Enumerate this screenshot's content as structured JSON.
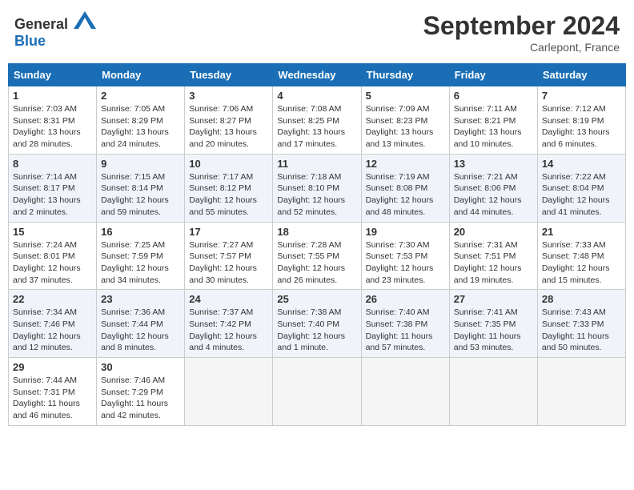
{
  "header": {
    "logo_general": "General",
    "logo_blue": "Blue",
    "month_title": "September 2024",
    "location": "Carlepont, France"
  },
  "weekdays": [
    "Sunday",
    "Monday",
    "Tuesday",
    "Wednesday",
    "Thursday",
    "Friday",
    "Saturday"
  ],
  "weeks": [
    [
      {
        "day": "1",
        "sunrise": "Sunrise: 7:03 AM",
        "sunset": "Sunset: 8:31 PM",
        "daylight": "Daylight: 13 hours and 28 minutes."
      },
      {
        "day": "2",
        "sunrise": "Sunrise: 7:05 AM",
        "sunset": "Sunset: 8:29 PM",
        "daylight": "Daylight: 13 hours and 24 minutes."
      },
      {
        "day": "3",
        "sunrise": "Sunrise: 7:06 AM",
        "sunset": "Sunset: 8:27 PM",
        "daylight": "Daylight: 13 hours and 20 minutes."
      },
      {
        "day": "4",
        "sunrise": "Sunrise: 7:08 AM",
        "sunset": "Sunset: 8:25 PM",
        "daylight": "Daylight: 13 hours and 17 minutes."
      },
      {
        "day": "5",
        "sunrise": "Sunrise: 7:09 AM",
        "sunset": "Sunset: 8:23 PM",
        "daylight": "Daylight: 13 hours and 13 minutes."
      },
      {
        "day": "6",
        "sunrise": "Sunrise: 7:11 AM",
        "sunset": "Sunset: 8:21 PM",
        "daylight": "Daylight: 13 hours and 10 minutes."
      },
      {
        "day": "7",
        "sunrise": "Sunrise: 7:12 AM",
        "sunset": "Sunset: 8:19 PM",
        "daylight": "Daylight: 13 hours and 6 minutes."
      }
    ],
    [
      {
        "day": "8",
        "sunrise": "Sunrise: 7:14 AM",
        "sunset": "Sunset: 8:17 PM",
        "daylight": "Daylight: 13 hours and 2 minutes."
      },
      {
        "day": "9",
        "sunrise": "Sunrise: 7:15 AM",
        "sunset": "Sunset: 8:14 PM",
        "daylight": "Daylight: 12 hours and 59 minutes."
      },
      {
        "day": "10",
        "sunrise": "Sunrise: 7:17 AM",
        "sunset": "Sunset: 8:12 PM",
        "daylight": "Daylight: 12 hours and 55 minutes."
      },
      {
        "day": "11",
        "sunrise": "Sunrise: 7:18 AM",
        "sunset": "Sunset: 8:10 PM",
        "daylight": "Daylight: 12 hours and 52 minutes."
      },
      {
        "day": "12",
        "sunrise": "Sunrise: 7:19 AM",
        "sunset": "Sunset: 8:08 PM",
        "daylight": "Daylight: 12 hours and 48 minutes."
      },
      {
        "day": "13",
        "sunrise": "Sunrise: 7:21 AM",
        "sunset": "Sunset: 8:06 PM",
        "daylight": "Daylight: 12 hours and 44 minutes."
      },
      {
        "day": "14",
        "sunrise": "Sunrise: 7:22 AM",
        "sunset": "Sunset: 8:04 PM",
        "daylight": "Daylight: 12 hours and 41 minutes."
      }
    ],
    [
      {
        "day": "15",
        "sunrise": "Sunrise: 7:24 AM",
        "sunset": "Sunset: 8:01 PM",
        "daylight": "Daylight: 12 hours and 37 minutes."
      },
      {
        "day": "16",
        "sunrise": "Sunrise: 7:25 AM",
        "sunset": "Sunset: 7:59 PM",
        "daylight": "Daylight: 12 hours and 34 minutes."
      },
      {
        "day": "17",
        "sunrise": "Sunrise: 7:27 AM",
        "sunset": "Sunset: 7:57 PM",
        "daylight": "Daylight: 12 hours and 30 minutes."
      },
      {
        "day": "18",
        "sunrise": "Sunrise: 7:28 AM",
        "sunset": "Sunset: 7:55 PM",
        "daylight": "Daylight: 12 hours and 26 minutes."
      },
      {
        "day": "19",
        "sunrise": "Sunrise: 7:30 AM",
        "sunset": "Sunset: 7:53 PM",
        "daylight": "Daylight: 12 hours and 23 minutes."
      },
      {
        "day": "20",
        "sunrise": "Sunrise: 7:31 AM",
        "sunset": "Sunset: 7:51 PM",
        "daylight": "Daylight: 12 hours and 19 minutes."
      },
      {
        "day": "21",
        "sunrise": "Sunrise: 7:33 AM",
        "sunset": "Sunset: 7:48 PM",
        "daylight": "Daylight: 12 hours and 15 minutes."
      }
    ],
    [
      {
        "day": "22",
        "sunrise": "Sunrise: 7:34 AM",
        "sunset": "Sunset: 7:46 PM",
        "daylight": "Daylight: 12 hours and 12 minutes."
      },
      {
        "day": "23",
        "sunrise": "Sunrise: 7:36 AM",
        "sunset": "Sunset: 7:44 PM",
        "daylight": "Daylight: 12 hours and 8 minutes."
      },
      {
        "day": "24",
        "sunrise": "Sunrise: 7:37 AM",
        "sunset": "Sunset: 7:42 PM",
        "daylight": "Daylight: 12 hours and 4 minutes."
      },
      {
        "day": "25",
        "sunrise": "Sunrise: 7:38 AM",
        "sunset": "Sunset: 7:40 PM",
        "daylight": "Daylight: 12 hours and 1 minute."
      },
      {
        "day": "26",
        "sunrise": "Sunrise: 7:40 AM",
        "sunset": "Sunset: 7:38 PM",
        "daylight": "Daylight: 11 hours and 57 minutes."
      },
      {
        "day": "27",
        "sunrise": "Sunrise: 7:41 AM",
        "sunset": "Sunset: 7:35 PM",
        "daylight": "Daylight: 11 hours and 53 minutes."
      },
      {
        "day": "28",
        "sunrise": "Sunrise: 7:43 AM",
        "sunset": "Sunset: 7:33 PM",
        "daylight": "Daylight: 11 hours and 50 minutes."
      }
    ],
    [
      {
        "day": "29",
        "sunrise": "Sunrise: 7:44 AM",
        "sunset": "Sunset: 7:31 PM",
        "daylight": "Daylight: 11 hours and 46 minutes."
      },
      {
        "day": "30",
        "sunrise": "Sunrise: 7:46 AM",
        "sunset": "Sunset: 7:29 PM",
        "daylight": "Daylight: 11 hours and 42 minutes."
      },
      null,
      null,
      null,
      null,
      null
    ]
  ]
}
